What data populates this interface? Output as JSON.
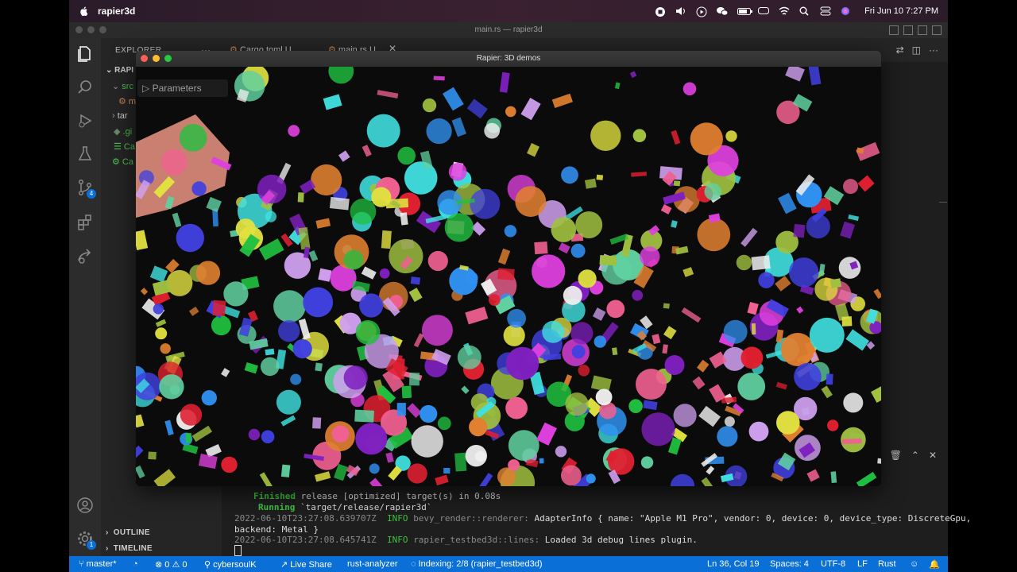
{
  "menubar": {
    "app_name": "rapier3d",
    "clock": "Fri Jun 10  7:27 PM"
  },
  "vscode": {
    "window_title": "main.rs — rapier3d",
    "explorer_title": "EXPLORER",
    "explorer_dots": "···",
    "project_label": "RAPI",
    "tree": [
      {
        "label": "src"
      },
      {
        "label": "m"
      },
      {
        "label": "tar"
      },
      {
        "label": ".gi"
      },
      {
        "label": "Ca"
      },
      {
        "label": "Ca"
      }
    ],
    "outline_label": "OUTLINE",
    "timeline_label": "TIMELINE",
    "tabs": [
      {
        "label": "Cargo.toml U"
      },
      {
        "label": "main.rs  U"
      }
    ],
    "activity_badges": {
      "scm": "4",
      "accounts": "1"
    }
  },
  "terminal": {
    "lines": [
      {
        "kind": "finished",
        "tag": "Finished",
        "text": " release [optimized] target(s) in 0.08s"
      },
      {
        "kind": "running",
        "tag": "Running",
        "text": " `target/release/rapier3d`"
      },
      {
        "kind": "log",
        "time": "2022-06-10T23:27:08.639707Z",
        "level": "INFO",
        "target": "bevy_render::renderer:",
        "msg": " AdapterInfo { name: \"Apple M1 Pro\", vendor: 0, device: 0, device_type: DiscreteGpu,"
      },
      {
        "kind": "cont",
        "text": "backend: Metal }"
      },
      {
        "kind": "log",
        "time": "2022-06-10T23:27:08.645741Z",
        "level": "INFO",
        "target": "rapier_testbed3d::lines:",
        "msg": " Loaded 3d debug lines plugin."
      }
    ]
  },
  "statusbar": {
    "branch": "master*",
    "errors": "0",
    "warnings": "0",
    "user": "cybersoulK",
    "live_share": "Live Share",
    "analyzer": "rust-analyzer",
    "indexing": "Indexing: 2/8 (rapier_testbed3d)",
    "position": "Ln 36, Col 19",
    "spaces": "Spaces: 4",
    "encoding": "UTF-8",
    "eol": "LF",
    "language": "Rust"
  },
  "rapier_window": {
    "title": "Rapier: 3D demos",
    "params_label": "Parameters"
  },
  "colors": {
    "statusbar": "#0a6fd6",
    "terminal_green": "#3ec23e"
  }
}
